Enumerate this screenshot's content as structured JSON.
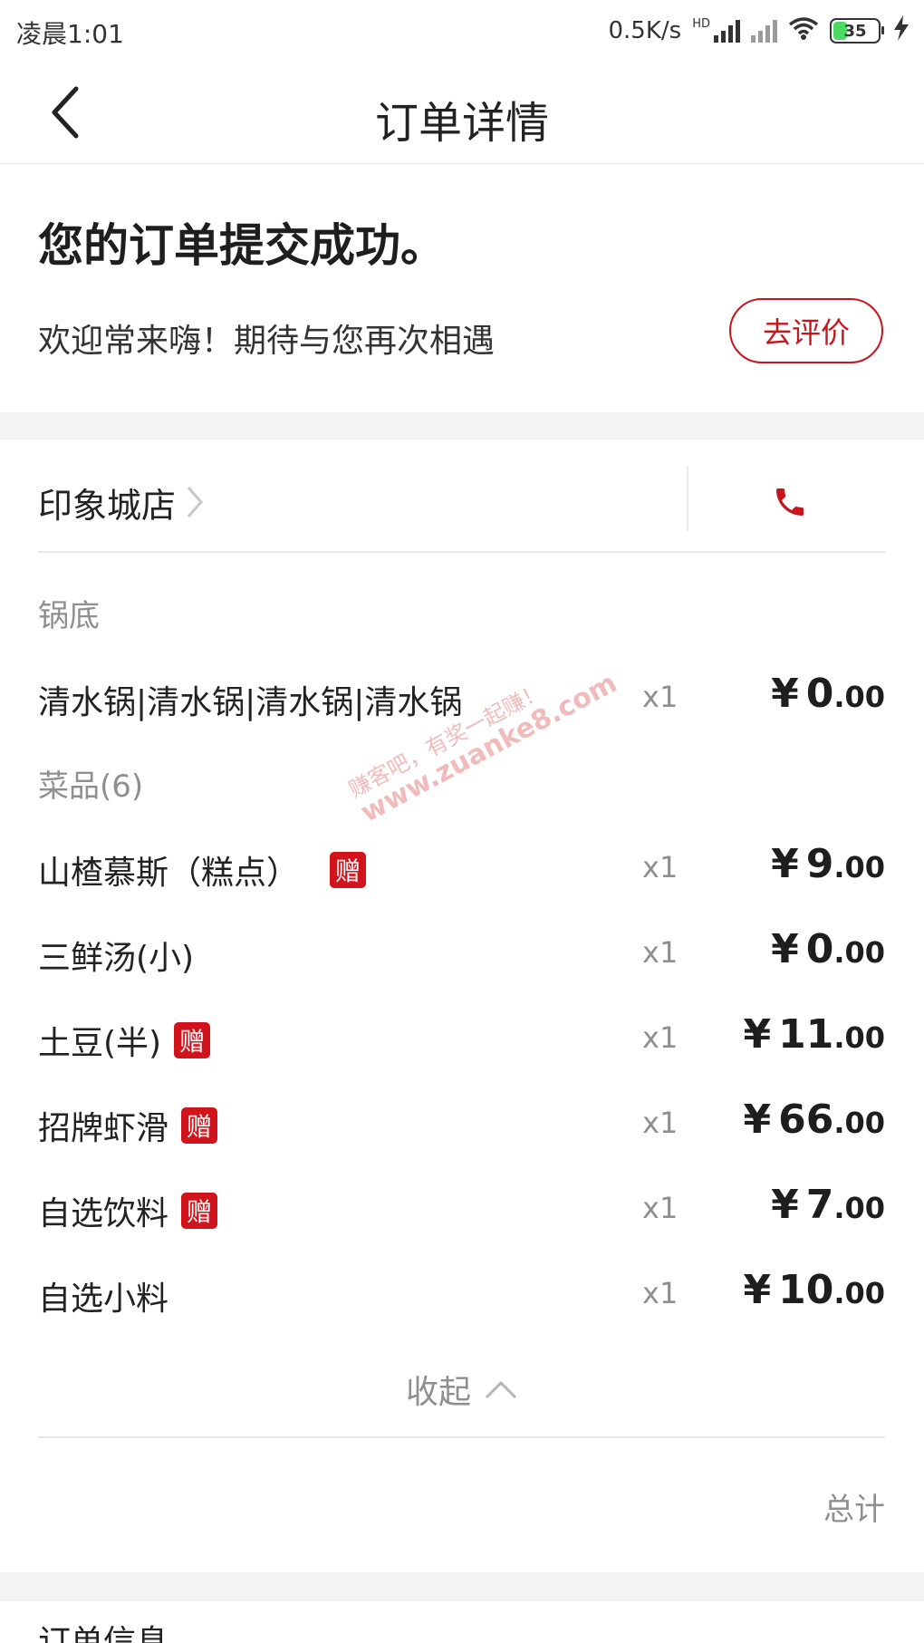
{
  "status_bar": {
    "time": "凌晨1:01",
    "network_speed": "0.5K/s",
    "network_type": "HD",
    "battery": "35",
    "battery_level": 0.35
  },
  "header": {
    "title": "订单详情",
    "back_icon": "chevron-left-icon"
  },
  "success": {
    "title": "您的订单提交成功。",
    "subtitle": "欢迎常来嗨！期待与您再次相遇",
    "review_button": "去评价"
  },
  "store": {
    "name": "印象城店",
    "chevron_icon": "chevron-right-icon",
    "phone_icon": "phone-icon",
    "accent_color": "#c8161d"
  },
  "sections": {
    "pot_label": "锅底",
    "dishes_label": "菜品(6)"
  },
  "gift_badge": "赠",
  "items": [
    {
      "name": "清水锅|清水锅|清水锅|清水锅",
      "qty": "x1",
      "currency": "¥",
      "price_int": "0",
      "price_dec": ".00",
      "gift": false
    },
    {
      "name": "山楂慕斯（糕点）",
      "qty": "x1",
      "currency": "¥",
      "price_int": "9",
      "price_dec": ".00",
      "gift": true
    },
    {
      "name": "三鲜汤(小)",
      "qty": "x1",
      "currency": "¥",
      "price_int": "0",
      "price_dec": ".00",
      "gift": false
    },
    {
      "name": "土豆(半)",
      "qty": "x1",
      "currency": "¥",
      "price_int": "11",
      "price_dec": ".00",
      "gift": true
    },
    {
      "name": "招牌虾滑",
      "qty": "x1",
      "currency": "¥",
      "price_int": "66",
      "price_dec": ".00",
      "gift": true
    },
    {
      "name": "自选饮料",
      "qty": "x1",
      "currency": "¥",
      "price_int": "7",
      "price_dec": ".00",
      "gift": true
    },
    {
      "name": "自选小料",
      "qty": "x1",
      "currency": "¥",
      "price_int": "10",
      "price_dec": ".00",
      "gift": false
    }
  ],
  "collapse": {
    "label": "收起",
    "icon": "chevron-up-icon"
  },
  "total": {
    "label": "总计"
  },
  "next_section_partial": "订单信息",
  "watermark": {
    "line1": "赚客吧，有奖一起赚！",
    "line2": "www.zuanke8.com"
  }
}
